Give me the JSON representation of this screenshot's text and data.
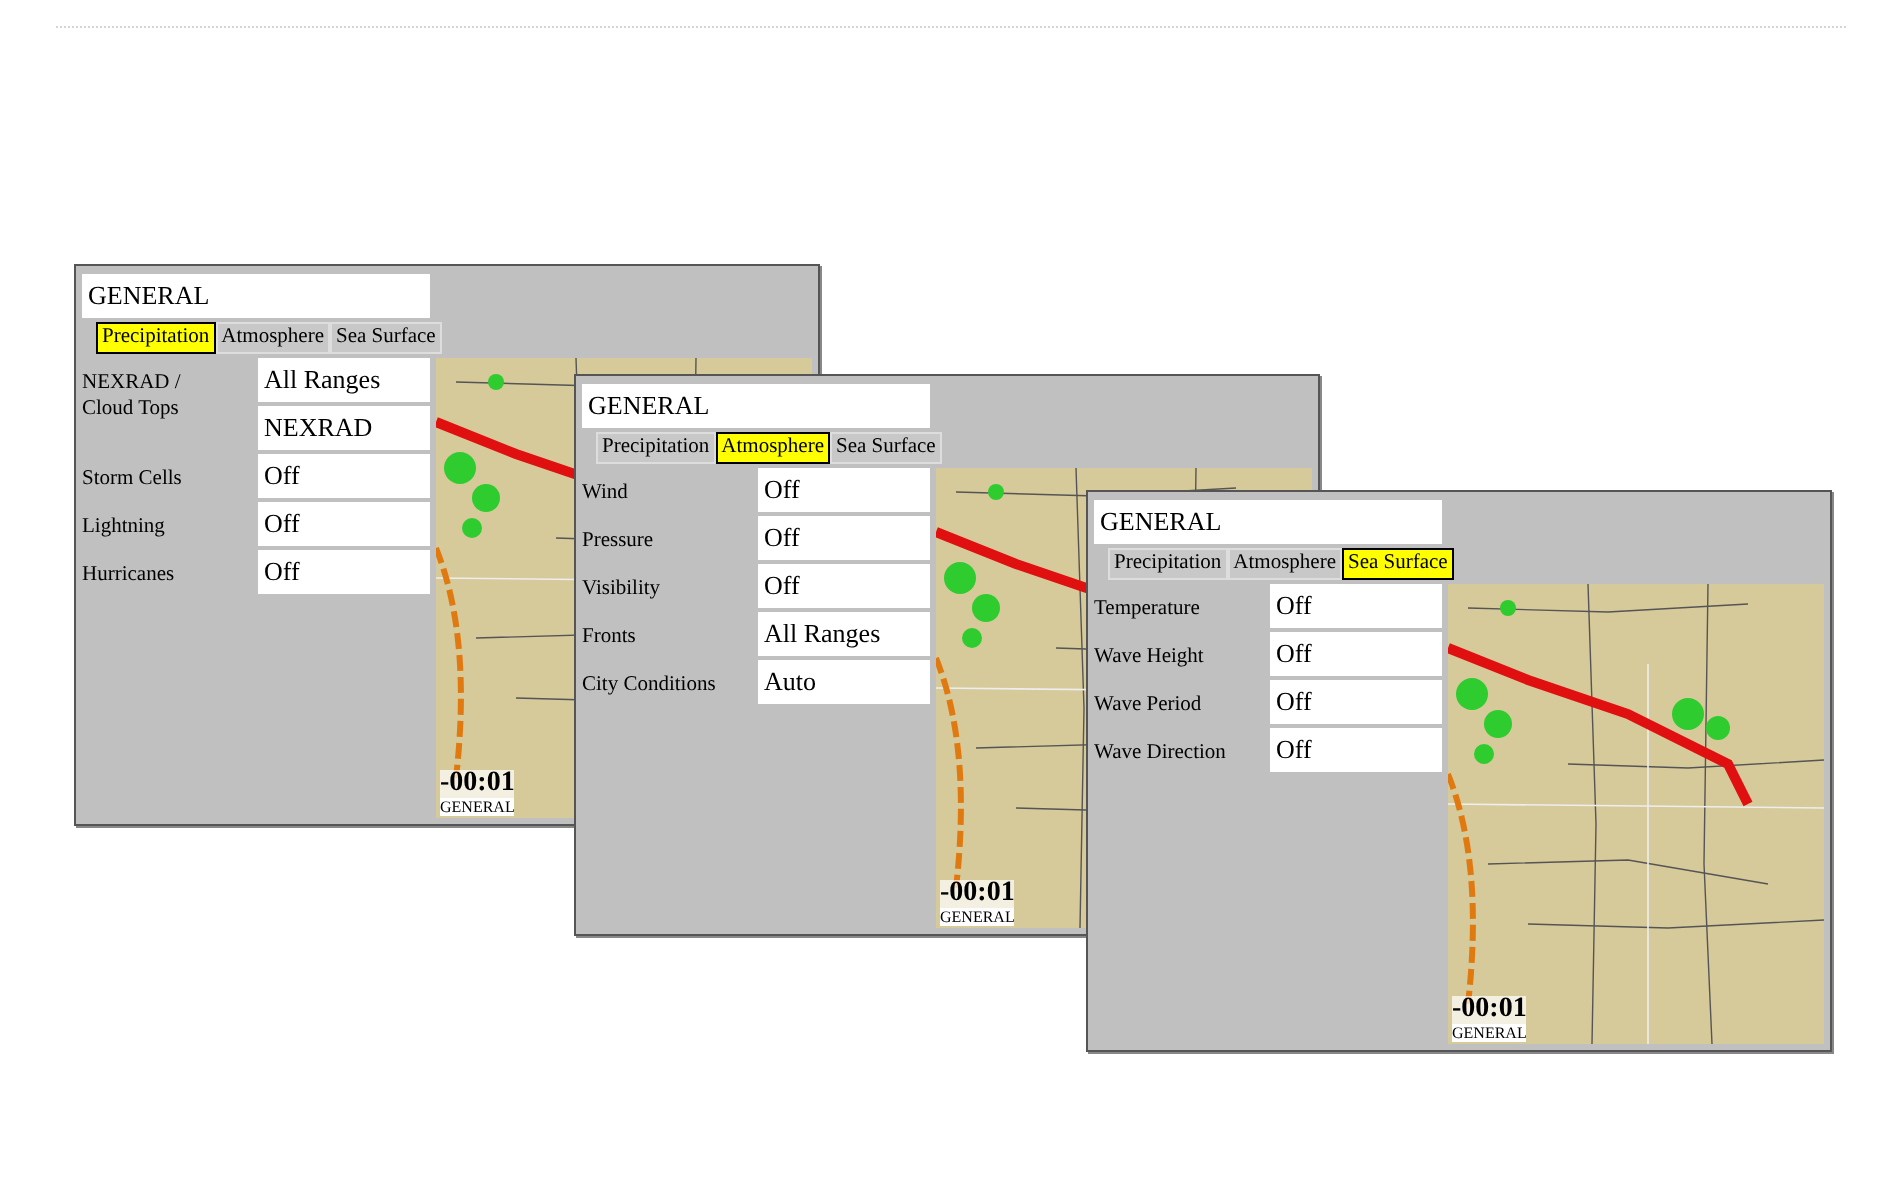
{
  "windows": [
    {
      "title": "GENERAL",
      "tabs": [
        {
          "label": "Precipitation",
          "selected": true
        },
        {
          "label": "Atmosphere",
          "selected": false
        },
        {
          "label": "Sea Surface",
          "selected": false
        }
      ],
      "rows": [
        {
          "label": "NEXRAD / Cloud Tops",
          "values": [
            "All Ranges",
            "NEXRAD"
          ]
        },
        {
          "label": "Storm Cells",
          "values": [
            "Off"
          ]
        },
        {
          "label": "Lightning",
          "values": [
            "Off"
          ]
        },
        {
          "label": "Hurricanes",
          "values": [
            "Off"
          ]
        }
      ],
      "map": {
        "time": "-00:01",
        "caption": "GENERAL"
      }
    },
    {
      "title": "GENERAL",
      "tabs": [
        {
          "label": "Precipitation",
          "selected": false
        },
        {
          "label": "Atmosphere",
          "selected": true
        },
        {
          "label": "Sea Surface",
          "selected": false
        }
      ],
      "rows": [
        {
          "label": "Wind",
          "values": [
            "Off"
          ]
        },
        {
          "label": "Pressure",
          "values": [
            "Off"
          ]
        },
        {
          "label": "Visibility",
          "values": [
            "Off"
          ]
        },
        {
          "label": "Fronts",
          "values": [
            "All Ranges"
          ]
        },
        {
          "label": "City Conditions",
          "values": [
            "Auto"
          ]
        }
      ],
      "map": {
        "time": "-00:01",
        "caption": "GENERAL"
      }
    },
    {
      "title": "GENERAL",
      "tabs": [
        {
          "label": "Precipitation",
          "selected": false
        },
        {
          "label": "Atmosphere",
          "selected": false
        },
        {
          "label": "Sea Surface",
          "selected": true
        }
      ],
      "rows": [
        {
          "label": "Temperature",
          "values": [
            "Off"
          ]
        },
        {
          "label": "Wave Height",
          "values": [
            "Off"
          ]
        },
        {
          "label": "Wave Period",
          "values": [
            "Off"
          ]
        },
        {
          "label": "Wave Direction",
          "values": [
            "Off"
          ]
        }
      ],
      "map": {
        "time": "-00:01",
        "caption": "GENERAL"
      }
    }
  ]
}
